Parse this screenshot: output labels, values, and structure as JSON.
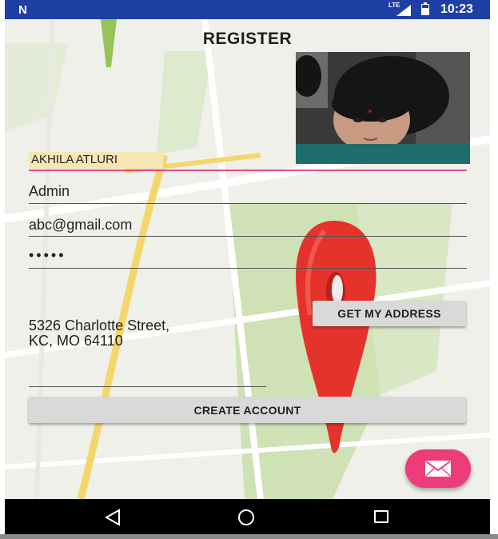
{
  "status_bar": {
    "notification_glyph": "N",
    "network_label": "LTE",
    "time": "10:23",
    "bar_color": "#1e3fa4"
  },
  "page": {
    "title": "REGISTER"
  },
  "form": {
    "name_value": "AKHILA ATLURI",
    "role_value": "Admin",
    "email_value": "abc@gmail.com",
    "password_value": "•••••",
    "address_line1": "5326 Charlotte Street,",
    "address_line2": "KC, MO 64110",
    "get_address_label": "GET MY ADDRESS",
    "create_account_label": "CREATE ACCOUNT"
  },
  "fab": {
    "icon": "mail-icon",
    "color": "#ec3d7a"
  },
  "nav": {
    "back_icon": "back-triangle-icon",
    "home_icon": "home-circle-icon",
    "recent_icon": "recent-apps-square-icon"
  }
}
